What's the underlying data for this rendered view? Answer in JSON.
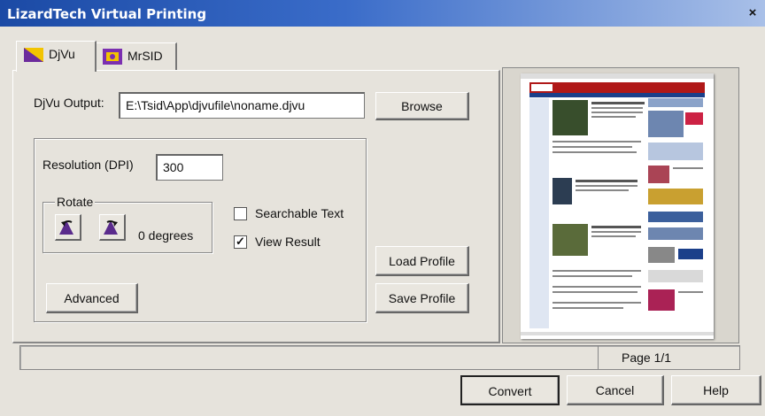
{
  "window": {
    "title": "LizardTech Virtual Printing",
    "close_glyph": "×"
  },
  "tabs": [
    {
      "label": "DjVu",
      "icon": "djvu-icon",
      "active": true
    },
    {
      "label": "MrSID",
      "icon": "mrsid-icon",
      "active": false
    }
  ],
  "output": {
    "label": "DjVu Output:",
    "value": "E:\\Tsid\\App\\djvufile\\noname.djvu",
    "browse_label": "Browse"
  },
  "resolution": {
    "label": "Resolution (DPI)",
    "value": "300"
  },
  "rotate": {
    "label": "Rotate",
    "degrees_text": "0 degrees"
  },
  "options": {
    "searchable_text": {
      "label": "Searchable Text",
      "checked": false
    },
    "view_result": {
      "label": "View Result",
      "checked": true
    }
  },
  "buttons": {
    "advanced": "Advanced",
    "load_profile": "Load Profile",
    "save_profile": "Save Profile",
    "convert": "Convert",
    "cancel": "Cancel",
    "help": "Help"
  },
  "preview": {
    "page_indicator": "Page 1/1"
  }
}
